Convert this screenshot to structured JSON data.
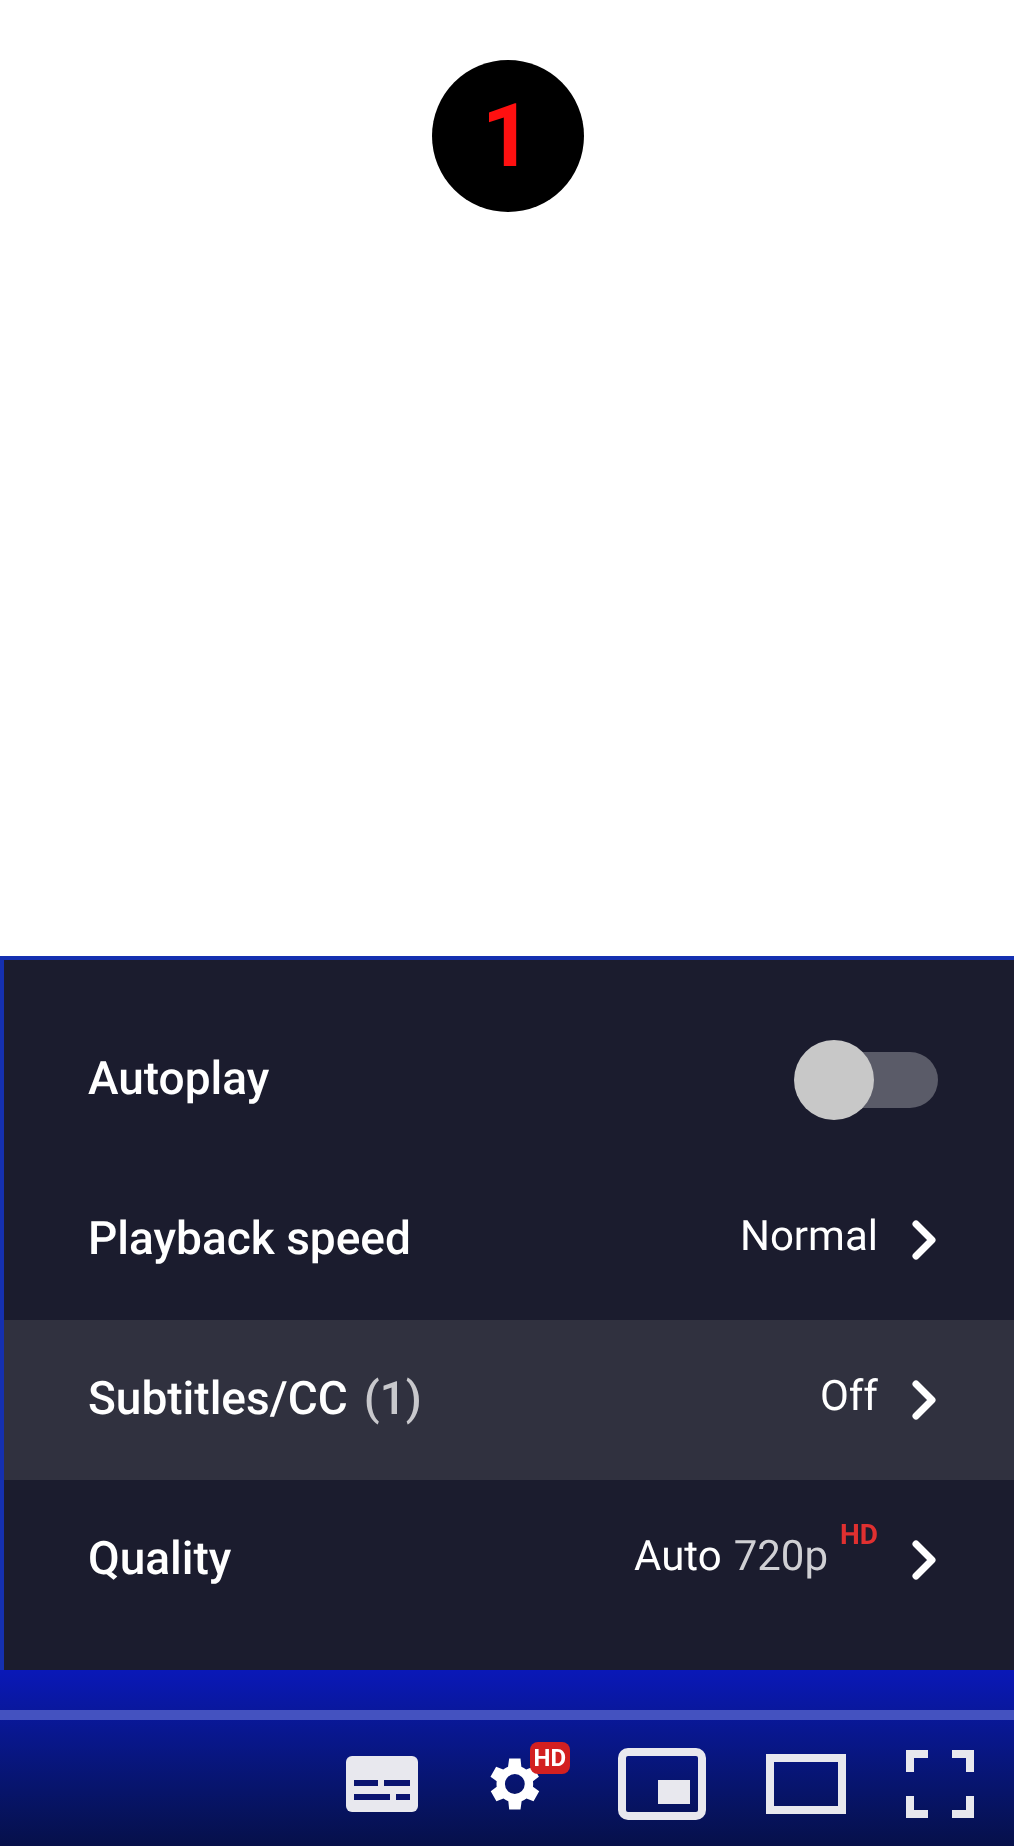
{
  "step_badge": "1",
  "menu": [
    {
      "kind": "toggle",
      "label": "Autoplay",
      "on": false,
      "selected": false
    },
    {
      "kind": "submenu",
      "label": "Playback speed",
      "value": "Normal",
      "selected": false
    },
    {
      "kind": "submenu",
      "label": "Subtitles/CC",
      "count": "(1)",
      "value": "Off",
      "selected": true
    },
    {
      "kind": "submenu",
      "label": "Quality",
      "value": "Auto",
      "detail": "720p",
      "tag": "HD",
      "selected": false
    }
  ],
  "settings_badge": "HD"
}
